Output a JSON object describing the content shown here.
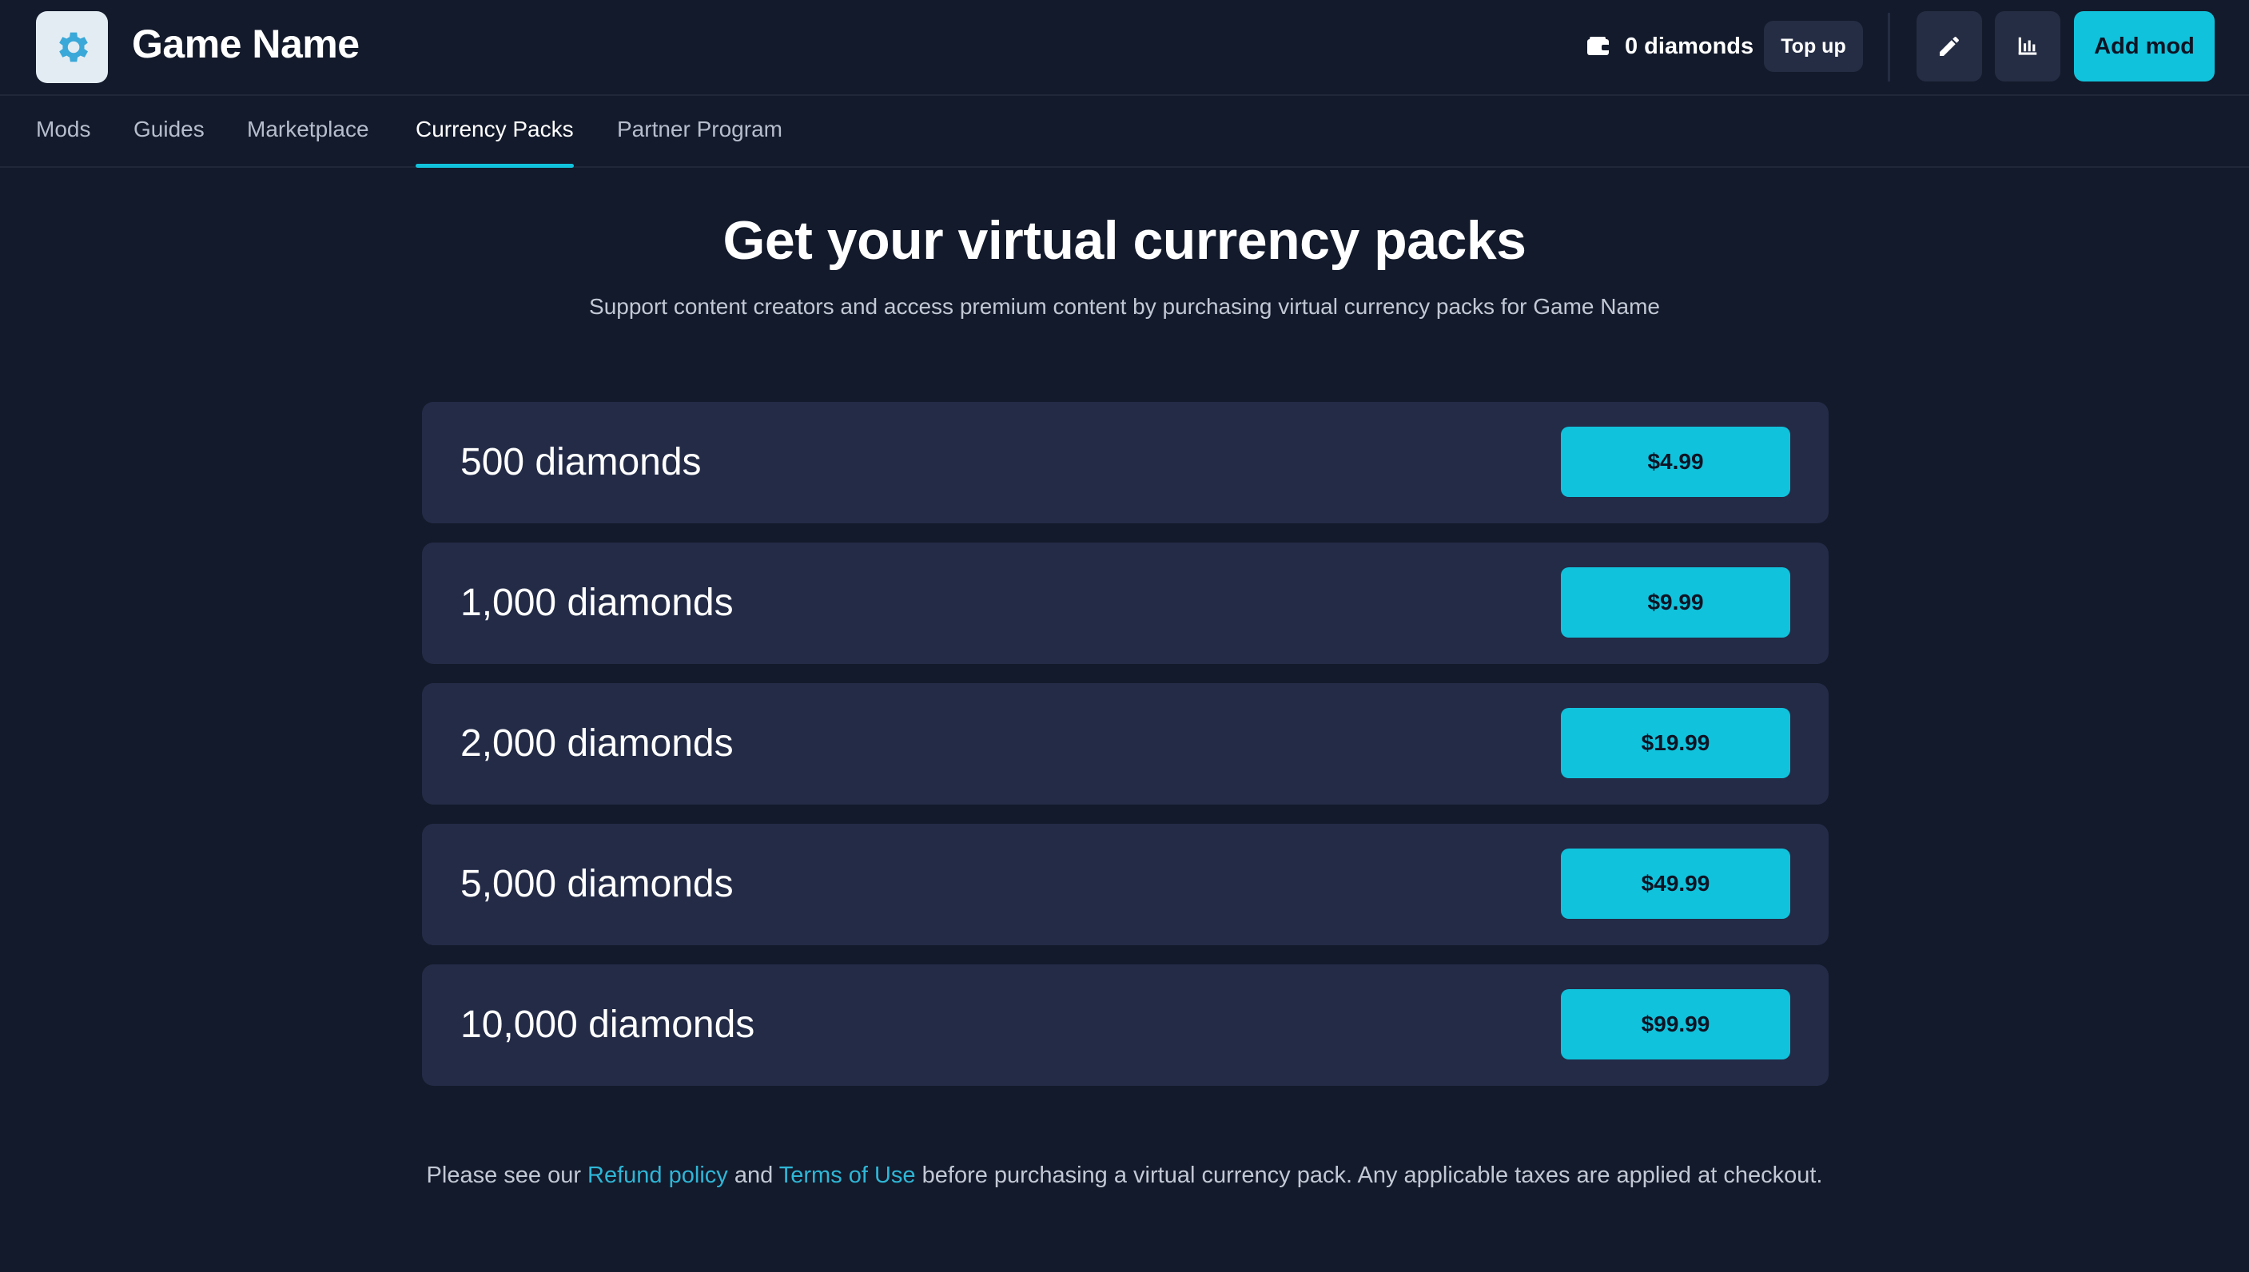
{
  "header": {
    "game_title": "Game Name",
    "wallet_balance": "0 diamonds",
    "topup_label": "Top up",
    "add_mod_label": "Add mod"
  },
  "tabs": [
    {
      "label": "Mods",
      "active": false
    },
    {
      "label": "Guides",
      "active": false
    },
    {
      "label": "Marketplace",
      "active": false
    },
    {
      "label": "Currency Packs",
      "active": true
    },
    {
      "label": "Partner Program",
      "active": false
    }
  ],
  "main": {
    "title": "Get your virtual currency packs",
    "subtitle": "Support content creators and access premium content by purchasing virtual currency packs for Game Name"
  },
  "packs": [
    {
      "label": "500 diamonds",
      "price": "$4.99"
    },
    {
      "label": "1,000 diamonds",
      "price": "$9.99"
    },
    {
      "label": "2,000 diamonds",
      "price": "$19.99"
    },
    {
      "label": "5,000 diamonds",
      "price": "$49.99"
    },
    {
      "label": "10,000 diamonds",
      "price": "$99.99"
    }
  ],
  "footer": {
    "pre": "Please see our ",
    "refund_link": "Refund policy",
    "mid": " and ",
    "terms_link": "Terms of Use",
    "post": " before purchasing a virtual currency pack. Any applicable taxes are applied at checkout."
  },
  "colors": {
    "background": "#131a2b",
    "card": "#232b47",
    "accent": "#11c2dc"
  },
  "icons": [
    "gear-logo-icon",
    "wallet-icon",
    "pencil-icon",
    "bar-chart-icon"
  ]
}
